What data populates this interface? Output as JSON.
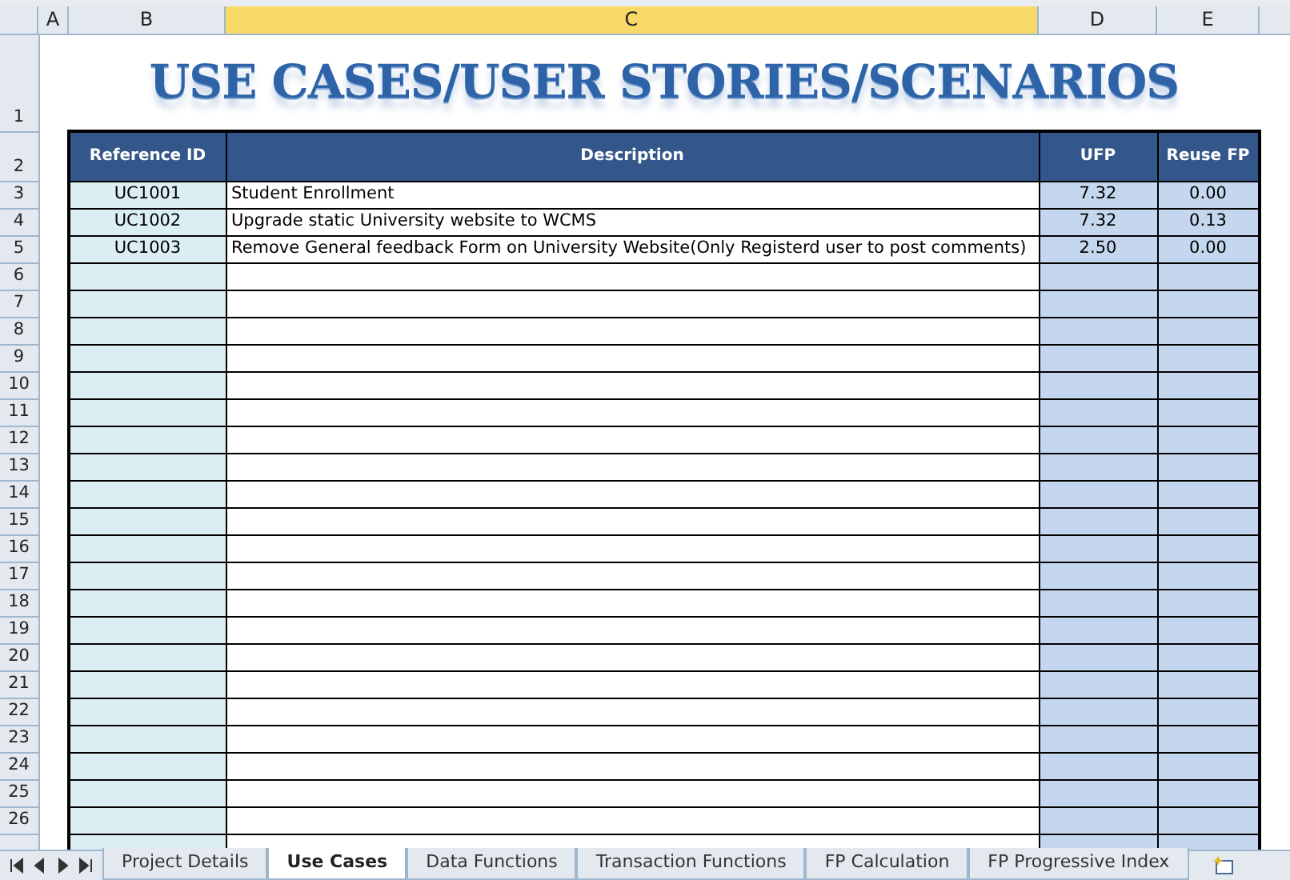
{
  "column_headers": [
    {
      "label": "A",
      "selected": false
    },
    {
      "label": "B",
      "selected": false
    },
    {
      "label": "C",
      "selected": true
    },
    {
      "label": "D",
      "selected": false
    },
    {
      "label": "E",
      "selected": false
    }
  ],
  "row_numbers": [
    "1",
    "2",
    "3",
    "4",
    "5",
    "6",
    "7",
    "8",
    "9",
    "10",
    "11",
    "12",
    "13",
    "14",
    "15",
    "16",
    "17",
    "18",
    "19",
    "20",
    "21",
    "22",
    "23",
    "24",
    "25",
    "26"
  ],
  "title": "USE CASES/USER STORIES/SCENARIOS",
  "table": {
    "columns": [
      "Reference ID",
      "Description",
      "UFP",
      "Reuse FP"
    ],
    "rows": [
      [
        "UC1001",
        "Student Enrollment",
        "7.32",
        "0.00"
      ],
      [
        "UC1002",
        "Upgrade static University website to WCMS",
        "7.32",
        "0.13"
      ],
      [
        "UC1003",
        "Remove General feedback Form on University Website(Only Registerd user to post comments)",
        "2.50",
        "0.00"
      ]
    ]
  },
  "sheet_tabs": [
    {
      "label": "Project Details",
      "selected": false
    },
    {
      "label": "Use Cases",
      "selected": true
    },
    {
      "label": "Data Functions",
      "selected": false
    },
    {
      "label": "Transaction Functions",
      "selected": false
    },
    {
      "label": "FP Calculation",
      "selected": false
    },
    {
      "label": "FP Progressive Index",
      "selected": false
    }
  ]
}
